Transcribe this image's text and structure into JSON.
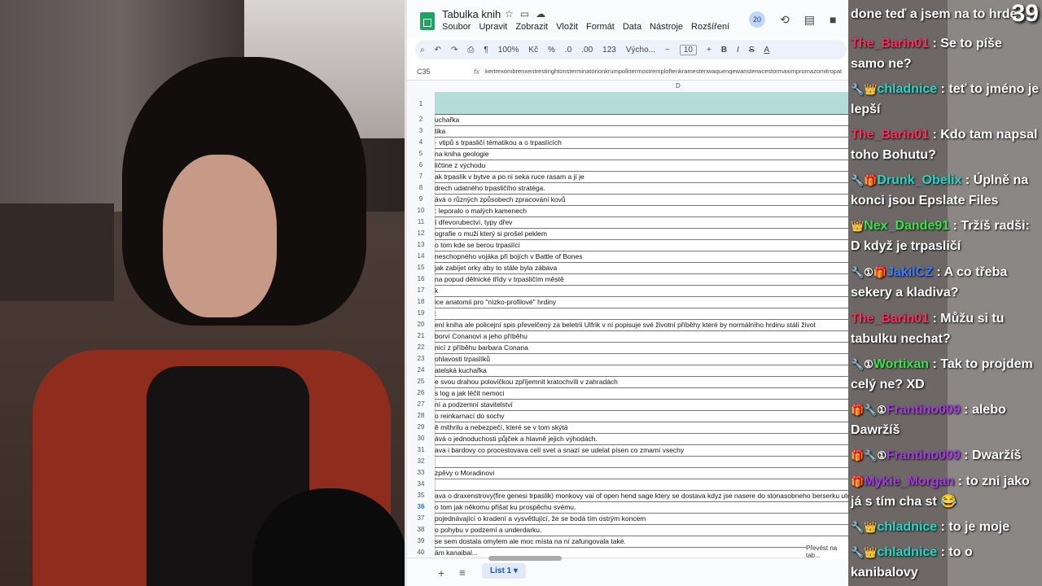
{
  "sheet": {
    "doc_title": "Tabulka knih",
    "menus": [
      "Soubor",
      "Upravit",
      "Zobrazit",
      "Vložit",
      "Formát",
      "Data",
      "Nástroje",
      "Rozšíření"
    ],
    "collaborators_badge": "20",
    "toolbar": {
      "zoom": "100%",
      "currency": "Kč",
      "percent": "%",
      "dec_down": ".0",
      "dec_up": ".00",
      "number_format": "123",
      "font": "Výcho...",
      "font_size": "10",
      "bold": "B",
      "italic": "I",
      "strike": "S",
      "text_color": "A"
    },
    "cell_ref": "C35",
    "formula_content": "kertrexombrenxentrestinghtonsterminatorionkrumpolktermostremploftenkramestenwaquenqewansterwcestormaximpromazomitropat",
    "column_header": "D",
    "rows": [
      {
        "n": "1",
        "text": ""
      },
      {
        "n": "2",
        "text": "uchařka"
      },
      {
        "n": "3",
        "text": "tika"
      },
      {
        "n": "4",
        "text": "· vtipů s trpasličí tématikou a o trpaslících"
      },
      {
        "n": "5",
        "text": "na kniha geologie"
      },
      {
        "n": "6",
        "text": "ličtine z východu"
      },
      {
        "n": "7",
        "text": "ak trpaslík v bytve a po ni seka ruce rasam a jí je"
      },
      {
        "n": "8",
        "text": "drech udatného trpasličího stratéga."
      },
      {
        "n": "9",
        "text": "ává o různých způsobech zpracování kovů"
      },
      {
        "n": "10",
        "text": ": leporalo o malých kamenech"
      },
      {
        "n": "11",
        "text": "í dřevorubectví, typy dřev"
      },
      {
        "n": "12",
        "text": "ografie o muži který si prošel peklem"
      },
      {
        "n": "13",
        "text": "o tom kde se berou trpaslící"
      },
      {
        "n": "14",
        "text": "neschopného vojáka při bojích v Battle of Bones"
      },
      {
        "n": "15",
        "text": "jak zabíjet orky aby to stále byla zábava"
      },
      {
        "n": "16",
        "text": "na popud dělnické třídy v trpasličím městě"
      },
      {
        "n": "17",
        "text": "k"
      },
      {
        "n": "18",
        "text": "ice anatomii pro \"nízko-profilové\" hrdiny"
      },
      {
        "n": "19",
        "text": ":"
      },
      {
        "n": "20",
        "text": "ení kniha ale policejní spis převelčený za beletrii Ulfrik v ní popisuje své životní příběhy které by normálního hrdinu stálí život"
      },
      {
        "n": "21",
        "text": "borví Conanovi a jeho příběhu"
      },
      {
        "n": "22",
        "text": "nicí z příběhu barbara Conana"
      },
      {
        "n": "23",
        "text": "ohlavosti trpaslíků"
      },
      {
        "n": "24",
        "text": "atelská kuchařka"
      },
      {
        "n": "25",
        "text": "e svou drahou polovičkou zpříjemnit kratochvíli v zahradách"
      },
      {
        "n": "26",
        "text": "s log a jak léčit nemoci"
      },
      {
        "n": "27",
        "text": "ní a podzemní stavitelství"
      },
      {
        "n": "28",
        "text": "o reinkarnací do sochy"
      },
      {
        "n": "29",
        "text": "ě mithrilu a nebezpečí, které se v tom skýtá"
      },
      {
        "n": "30",
        "text": "ává o jednoduchosti půjček a hlavně jejich výhodách."
      },
      {
        "n": "31",
        "text": "ava i bardovy co procestovava celí svet a snazí se udelat písen co zmamí vsechy"
      },
      {
        "n": "32",
        "text": ""
      },
      {
        "n": "33",
        "text": "zpěvy o Moradinovi"
      },
      {
        "n": "34",
        "text": ""
      },
      {
        "n": "35",
        "text": "ava o draxenstrovy(fire genesi trpaslik) monkovy vai of open hend sage ktery se dostava kdyz jse nasere do stonasobneho berserku utoci do vsech"
      },
      {
        "n": "36",
        "text": "o tom jak někomu přišat ku prospěchu svému."
      },
      {
        "n": "37",
        "text": "pojednávající o kradení a vysvětlující, že se bodá tím ostrým koncem"
      },
      {
        "n": "38",
        "text": "o pohybu v podzemí a underdarku."
      },
      {
        "n": "39",
        "text": "se sem dostala omylem ale moc místa na ní zafungovala také."
      },
      {
        "n": "40",
        "text": "ám kanaibal..."
      }
    ],
    "selected_row": "36",
    "sheet_tab": "List 1",
    "convert_label": "Převést na tab..."
  },
  "chat": {
    "corner_count": "39",
    "messages": [
      {
        "user": "",
        "user_color": "#ffffff",
        "badges": "",
        "text": "done teď a jsem na to hrde"
      },
      {
        "user": "The_Barin01",
        "user_color": "#ff2f5c",
        "badges": "",
        "text": ": Se to píše samo ne?"
      },
      {
        "user": "chladnice",
        "user_color": "#25d7c8",
        "badges": "🔧👑",
        "text": ": teť to jméno je lepší"
      },
      {
        "user": "The_Barin01",
        "user_color": "#ff2f5c",
        "badges": "",
        "text": ": Kdo tam napsal toho Bohutu?"
      },
      {
        "user": "Drunk_Obelix",
        "user_color": "#25d7c8",
        "badges": "🔧🎁",
        "text": ": Úplně na konci jsou Epslate Files"
      },
      {
        "user": "Nex_Dande91",
        "user_color": "#39e24f",
        "badges": "👑",
        "text": ": Tržíš radši: D když je trpasličí"
      },
      {
        "user": "JakilCZ",
        "user_color": "#3d7bff",
        "badges": "🔧①🎁",
        "text": ": A co třeba sekery a kladiva?"
      },
      {
        "user": "The_Barin01",
        "user_color": "#ff2f5c",
        "badges": "",
        "text": ": Můžu si tu tabulku nechat?"
      },
      {
        "user": "Wortixan",
        "user_color": "#39e24f",
        "badges": "🔧①",
        "text": ": Tak to projdem celý ne? XD"
      },
      {
        "user": "Frantino009",
        "user_color": "#a43be0",
        "badges": "🎁🔧①",
        "text": ": alebo Dawržíš"
      },
      {
        "user": "Frantino009",
        "user_color": "#a43be0",
        "badges": "🎁🔧①",
        "text": ": Dwaržíš"
      },
      {
        "user": "Mykie_Morgan",
        "user_color": "#a43be0",
        "badges": "🎁",
        "text": ": to zni jako já s tím cha st 😂"
      },
      {
        "user": "chladnice",
        "user_color": "#25d7c8",
        "badges": "🔧👑",
        "text": ": to je moje"
      },
      {
        "user": "chladnice",
        "user_color": "#25d7c8",
        "badges": "🔧👑",
        "text": ": to o kanibalovy"
      }
    ]
  }
}
